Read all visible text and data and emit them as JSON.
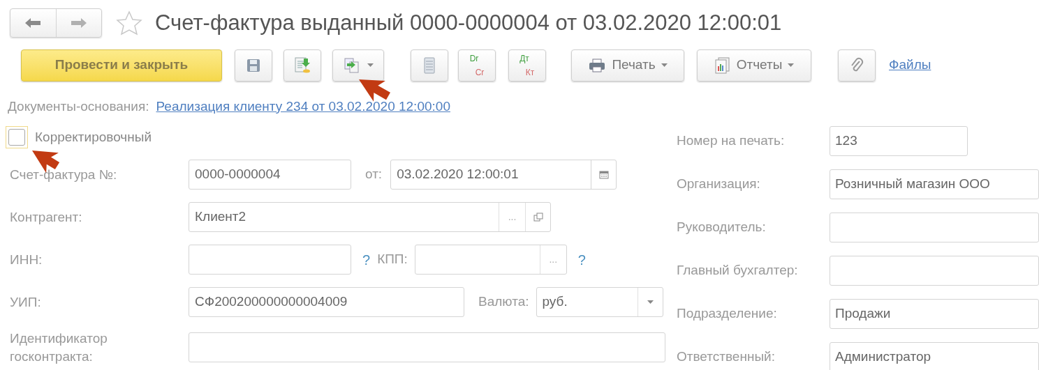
{
  "header": {
    "title": "Счет-фактура выданный 0000-0000004 от 03.02.2020 12:00:01",
    "favorite": false
  },
  "toolbar": [
    {
      "kind": "primary",
      "label": "Провести и закрыть"
    },
    {
      "kind": "save"
    },
    {
      "kind": "post"
    },
    {
      "kind": "create",
      "dropdown": true
    },
    {
      "kind": "list"
    },
    {
      "kind": "drcr",
      "top": "Dr",
      "bottom": "Cr"
    },
    {
      "kind": "drcr",
      "top": "Дт",
      "bottom": "Кт"
    },
    {
      "kind": "print",
      "label": "Печать",
      "dropdown": true
    },
    {
      "kind": "reports",
      "label": "Отчеты",
      "dropdown": true
    },
    {
      "kind": "attach"
    },
    {
      "kind": "link",
      "label": "Файлы"
    }
  ],
  "basis": {
    "label": "Документы-основания:",
    "link": "Реализация клиенту 234 от 03.02.2020 12:00:00"
  },
  "corrective": {
    "label": "Корректировочный",
    "checked": false
  },
  "left_rows": [
    {
      "label": "Счет-фактура №:",
      "items": [
        {
          "kind": "input",
          "value": "0000-0000004"
        },
        {
          "kind": "label",
          "text": "от:"
        },
        {
          "kind": "date",
          "value": "03.02.2020 12:00:01"
        }
      ]
    },
    {
      "label": "Контрагент:",
      "items": [
        {
          "kind": "ref",
          "value": "Клиент2",
          "button": "..."
        }
      ]
    },
    {
      "label": "ИНН:",
      "items": [
        {
          "kind": "input"
        },
        {
          "kind": "help",
          "text": "?"
        },
        {
          "kind": "label",
          "text": "КПП:"
        },
        {
          "kind": "choice",
          "button": "..."
        },
        {
          "kind": "help",
          "text": "?"
        }
      ]
    },
    {
      "label": "УИП:",
      "items": [
        {
          "kind": "input",
          "value": "СФ200200000000004009"
        },
        {
          "kind": "label",
          "text": "Валюта:"
        },
        {
          "kind": "select",
          "value": "руб."
        }
      ]
    },
    {
      "label": "Идентификатор госконтракта:",
      "items": [
        {
          "kind": "input"
        }
      ]
    }
  ],
  "right_fields": [
    {
      "label": "Номер на печать:",
      "value": "123"
    },
    {
      "label": "Организация:",
      "value": "Розничный магазин ООО"
    },
    {
      "label": "Руководитель:"
    },
    {
      "label": "Главный бухгалтер:"
    },
    {
      "label": "Подразделение:",
      "value": "Продажи"
    },
    {
      "label": "Ответственный:",
      "value": "Администратор"
    }
  ]
}
